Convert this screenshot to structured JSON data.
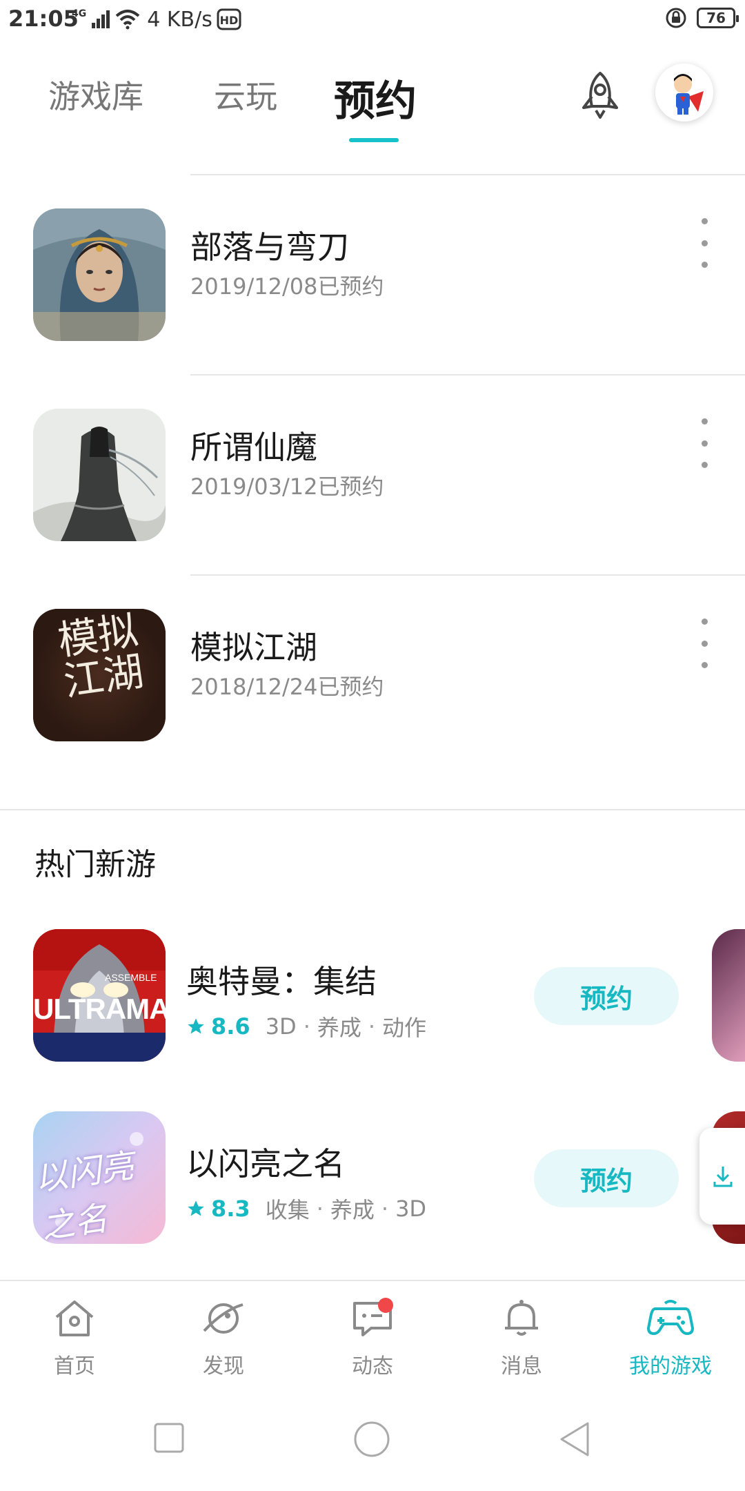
{
  "status_bar": {
    "time": "21:05",
    "network": "4G",
    "speed": "4 KB/s",
    "hd": "HD",
    "battery": "76"
  },
  "tabs": [
    {
      "label": "游戏库",
      "active": false
    },
    {
      "label": "云玩",
      "active": false
    },
    {
      "label": "预约",
      "active": true
    }
  ],
  "reserved": [
    {
      "title": "部落与弯刀",
      "date": "2019/12/08已预约"
    },
    {
      "title": "所谓仙魔",
      "date": "2019/03/12已预约"
    },
    {
      "title": "模拟江湖",
      "date": "2018/12/24已预约"
    }
  ],
  "hot_section": {
    "title": "热门新游",
    "games": [
      {
        "title": "奥特曼：集结",
        "rating": "8.6",
        "tags": [
          "3D",
          "养成",
          "动作"
        ],
        "button": "预约"
      },
      {
        "title": "以闪亮之名",
        "rating": "8.3",
        "tags": [
          "收集",
          "养成",
          "3D"
        ],
        "button": "预约"
      }
    ]
  },
  "icon_art": {
    "ultraman_text": "ULTRAMAN",
    "ultraman_tag": "ASSEMBLE",
    "shining_name": "以闪亮之名",
    "jianghu_calligraphy": "模拟江湖"
  },
  "bottom_nav": [
    {
      "label": "首页",
      "icon": "home-icon",
      "active": false
    },
    {
      "label": "发现",
      "icon": "planet-icon",
      "active": false
    },
    {
      "label": "动态",
      "icon": "chat-icon",
      "active": false,
      "badge": true
    },
    {
      "label": "消息",
      "icon": "bell-icon",
      "active": false
    },
    {
      "label": "我的游戏",
      "icon": "gamepad-icon",
      "active": true
    }
  ],
  "colors": {
    "accent": "#17c1c9",
    "badge": "#f04848"
  }
}
